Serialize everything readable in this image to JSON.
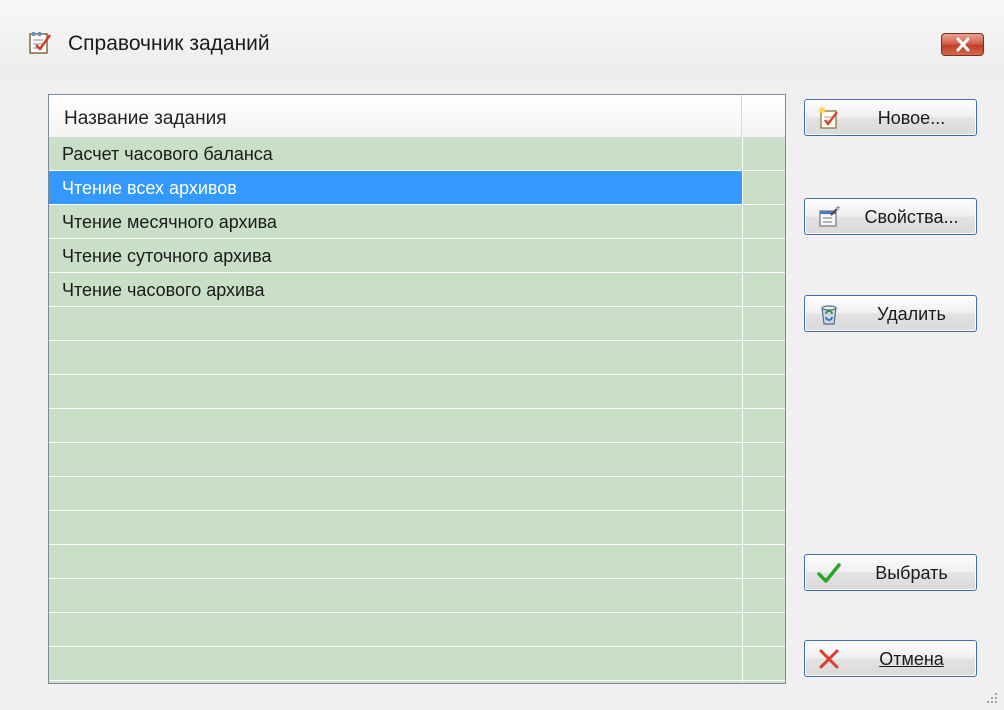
{
  "window": {
    "title": "Справочник заданий",
    "icon": "task-directory-icon"
  },
  "list": {
    "column_header": "Название задания",
    "rows": [
      "Расчет часового баланса",
      "Чтение всех архивов",
      "Чтение месячного архива",
      "Чтение суточного архива",
      "Чтение часового архива"
    ],
    "selected_index": 1
  },
  "buttons": {
    "new": "Новое...",
    "properties": "Свойства...",
    "delete": "Удалить",
    "select": "Выбрать",
    "cancel": "Отмена"
  },
  "colors": {
    "list_background": "#c9dfc7",
    "selection": "#3399ff",
    "button_border": "#3c6fb0",
    "close_button": "#c13e27"
  }
}
